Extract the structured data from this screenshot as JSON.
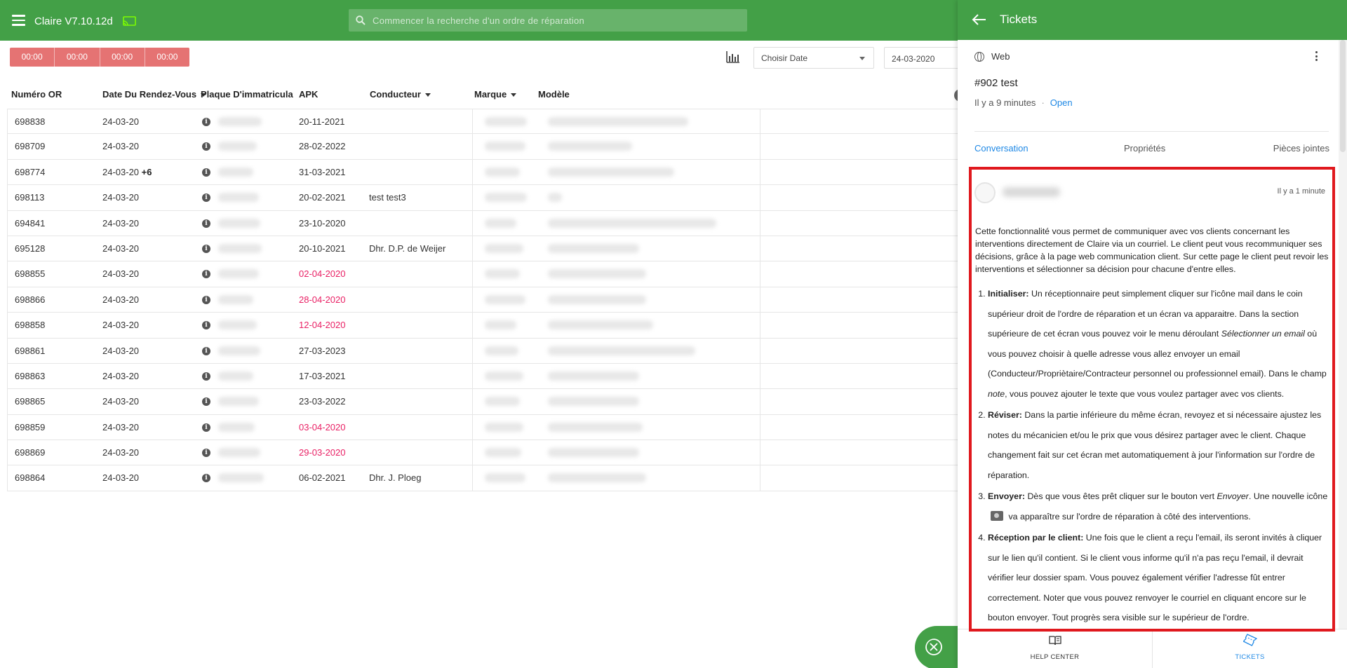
{
  "app": {
    "title": "Claire V7.10.12d",
    "cast_icon": "cast-icon"
  },
  "search": {
    "placeholder": "Commencer la recherche d'un ordre de réparation"
  },
  "toolbar": {
    "time_chips": [
      "00:00",
      "00:00",
      "00:00",
      "00:00"
    ],
    "date_select_label": "Choisir Date",
    "date_value": "24-03-2020"
  },
  "table": {
    "headers": {
      "or": "Numéro OR",
      "date": "Date Du Rendez-Vous",
      "plate": "Plaque D'immatriculation",
      "apk": "APK",
      "driver": "Conducteur",
      "brand": "Marque",
      "model": "Modèle"
    },
    "rows": [
      {
        "or": "698838",
        "date": "24-03-20",
        "extra": "",
        "apk": "20-11-2021",
        "apk_alert": false,
        "driver": ""
      },
      {
        "or": "698709",
        "date": "24-03-20",
        "extra": "",
        "apk": "28-02-2022",
        "apk_alert": false,
        "driver": ""
      },
      {
        "or": "698774",
        "date": "24-03-20",
        "extra": "+6",
        "apk": "31-03-2021",
        "apk_alert": false,
        "driver": ""
      },
      {
        "or": "698113",
        "date": "24-03-20",
        "extra": "",
        "apk": "20-02-2021",
        "apk_alert": false,
        "driver": "test test3"
      },
      {
        "or": "694841",
        "date": "24-03-20",
        "extra": "",
        "apk": "23-10-2020",
        "apk_alert": false,
        "driver": ""
      },
      {
        "or": "695128",
        "date": "24-03-20",
        "extra": "",
        "apk": "20-10-2021",
        "apk_alert": false,
        "driver": "Dhr. D.P. de Weijer"
      },
      {
        "or": "698855",
        "date": "24-03-20",
        "extra": "",
        "apk": "02-04-2020",
        "apk_alert": true,
        "driver": ""
      },
      {
        "or": "698866",
        "date": "24-03-20",
        "extra": "",
        "apk": "28-04-2020",
        "apk_alert": true,
        "driver": ""
      },
      {
        "or": "698858",
        "date": "24-03-20",
        "extra": "",
        "apk": "12-04-2020",
        "apk_alert": true,
        "driver": ""
      },
      {
        "or": "698861",
        "date": "24-03-20",
        "extra": "",
        "apk": "27-03-2023",
        "apk_alert": false,
        "driver": ""
      },
      {
        "or": "698863",
        "date": "24-03-20",
        "extra": "",
        "apk": "17-03-2021",
        "apk_alert": false,
        "driver": ""
      },
      {
        "or": "698865",
        "date": "24-03-20",
        "extra": "",
        "apk": "23-03-2022",
        "apk_alert": false,
        "driver": ""
      },
      {
        "or": "698859",
        "date": "24-03-20",
        "extra": "",
        "apk": "03-04-2020",
        "apk_alert": true,
        "driver": ""
      },
      {
        "or": "698869",
        "date": "24-03-20",
        "extra": "",
        "apk": "29-03-2020",
        "apk_alert": true,
        "driver": ""
      },
      {
        "or": "698864",
        "date": "24-03-20",
        "extra": "",
        "apk": "06-02-2021",
        "apk_alert": false,
        "driver": "Dhr. J. Ploeg"
      }
    ]
  },
  "panel": {
    "title": "Tickets",
    "channel": "Web",
    "ticket_title": "#902 test",
    "ticket_age": "Il y a 9 minutes",
    "ticket_status": "Open",
    "tabs": [
      "Conversation",
      "Propriétés",
      "Pièces jointes"
    ],
    "message": {
      "time": "Il y a 1 minute",
      "intro": "Cette fonctionnalité vous permet de communiquer avec vos clients  concernant les interventions directement de Claire via un courriel. Le client peut vous recommuniquer ses décisions, grâce à la page web communication client. Sur cette page le client peut revoir les interventions et sélectionner sa décision pour chacune d'entre elles.",
      "steps": [
        {
          "title": "Initialiser:",
          "p1": " Un réceptionnaire peut simplement cliquer sur l'icône mail dans le coin supérieur droit de l'ordre de réparation et un écran va apparaitre. Dans la section supérieure de cet écran vous pouvez voir le menu déroulant ",
          "em1": "Sélectionner un email",
          "p2": " où vous pouvez choisir à quelle adresse vous allez envoyer un email (Conducteur/Propriètaire/Contracteur personnel ou professionnel email). Dans le champ ",
          "em2": "note",
          "p3": ", vous pouvez ajouter le texte que vous voulez partager avec vos clients."
        },
        {
          "title": "Réviser:",
          "p1": " Dans la partie inférieure du même écran, revoyez et si nécessaire ajustez les notes du mécanicien et/ou le prix que vous désirez partager avec le client. Chaque changement fait sur cet écran met automatiquement à jour l'information sur l'ordre de réparation."
        },
        {
          "title": "Envoyer:",
          "p1": " Dès que vous êtes prêt cliquer sur le bouton vert ",
          "em1": "Envoyer",
          "p2": ". Une nouvelle icône ",
          "p3": " va apparaître sur l'ordre de réparation à côté des interventions."
        },
        {
          "title": "Réception par le client:",
          "p1": " Une fois que le client a reçu l'email, ils seront invités à cliquer sur le lien qu'il contient. Si le client vous informe qu'il n'a pas reçu l'email, il devrait vérifier leur dossier spam. Vous pouvez également vérifier l'adresse fût entrer correctement. Noter que vous pouvez renvoyer le courriel en cliquant encore sur le bouton envoyer. Tout progrès sera visible sur le supérieur de l'ordre."
        }
      ]
    },
    "nav": {
      "help": "HELP CENTER",
      "tickets": "TICKETS"
    },
    "colors": {
      "brand_green": "#43a047",
      "link_blue": "#1e88e5",
      "highlight_red": "#e0191e",
      "alert_pink": "#e91e63"
    }
  }
}
